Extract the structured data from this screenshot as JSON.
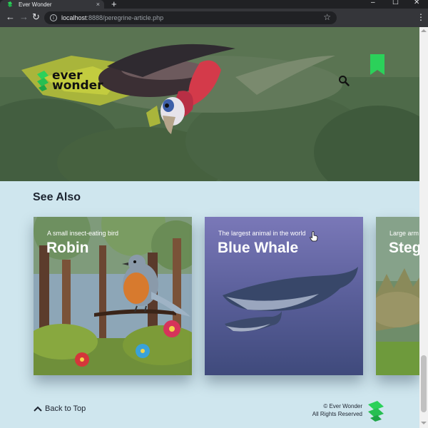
{
  "browser": {
    "tab_title": "Ever Wonder",
    "tab_close": "×",
    "new_tab": "+",
    "url_host": "localhost",
    "url_rest": ":8888/peregrine-article.php",
    "back": "←",
    "forward": "→",
    "reload": "↻",
    "star": "☆",
    "menu": "⋮",
    "minimize": "–",
    "maximize": "☐",
    "close": "✕"
  },
  "header": {
    "logo_line1": "ever",
    "logo_line2": "wonder",
    "icons": [
      "search-icon",
      "bookmark-icon"
    ]
  },
  "see_also": {
    "title": "See Also",
    "cards": [
      {
        "subtitle": "A small insect-eating bird",
        "title": "Robin"
      },
      {
        "subtitle": "The largest animal in the world",
        "title": "Blue Whale"
      },
      {
        "subtitle": "Large arm",
        "title": "Steg"
      }
    ]
  },
  "footer": {
    "back_to_top": "Back to Top",
    "copyright_line1": "© Ever Wonder",
    "copyright_line2": "All Rights Reserved"
  },
  "colors": {
    "brand_green": "#2bd15a",
    "background": "#cfe6ee",
    "text_dark": "#1d2430"
  }
}
